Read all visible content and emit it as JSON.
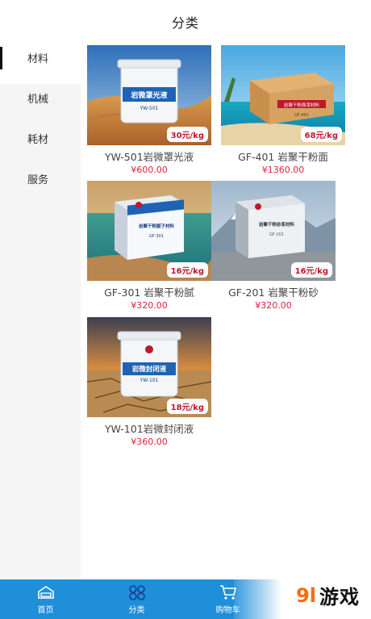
{
  "header": {
    "title": "分类"
  },
  "sidebar": {
    "items": [
      {
        "label": "材料",
        "active": true
      },
      {
        "label": "机械",
        "active": false
      },
      {
        "label": "耗材",
        "active": false
      },
      {
        "label": "服务",
        "active": false
      }
    ]
  },
  "products": [
    {
      "name": "YW-501岩微罩光液",
      "price": "¥600.00",
      "tag": "30元/kg",
      "pkg_label": "岩微罩光液",
      "pkg_model": "YW-501"
    },
    {
      "name": "GF-401 岩聚干粉面",
      "price": "¥1360.00",
      "tag": "68元/kg",
      "pkg_label": "岩聚干粉面漆材料",
      "pkg_model": "GF-401"
    },
    {
      "name": "GF-301 岩聚干粉腻",
      "price": "¥320.00",
      "tag": "16元/kg",
      "pkg_label": "岩聚干粉腻子材料",
      "pkg_model": "GF-301"
    },
    {
      "name": "GF-201 岩聚干粉砂",
      "price": "¥320.00",
      "tag": "16元/kg",
      "pkg_label": "岩聚干粉砂浆材料",
      "pkg_model": "GF-201"
    },
    {
      "name": "YW-101岩微封闭液",
      "price": "¥360.00",
      "tag": "18元/kg",
      "pkg_label": "岩微封闭液",
      "pkg_model": "YW-101"
    }
  ],
  "tabbar": {
    "tabs": [
      {
        "label": "首页",
        "icon": "home-icon"
      },
      {
        "label": "分类",
        "icon": "category-icon"
      },
      {
        "label": "购物车",
        "icon": "cart-icon"
      }
    ]
  },
  "watermark": {
    "logo": "9l",
    "text": "游戏"
  },
  "colors": {
    "accent": "#1f8fd9",
    "price": "#e0223a",
    "tag": "#c0182b"
  }
}
